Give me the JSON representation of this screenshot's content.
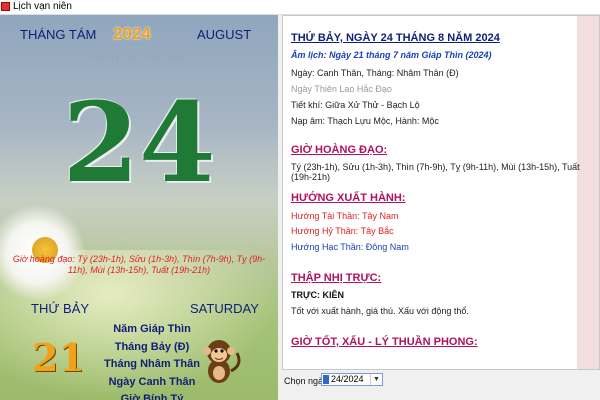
{
  "window": {
    "title": "Lịch vạn niên"
  },
  "left": {
    "month_vn": "THÁNG TÁM",
    "year": "2024",
    "month_en": "AUGUST",
    "day_quality": "THIÊN LAO HẮC ĐẠO",
    "day_number": "24",
    "gio_hoang_dao": "Giờ hoàng đạo: Tý (23h-1h), Sửu (1h-3h), Thìn (7h-9h), Tỵ (9h-11h), Mùi (13h-15h), Tuất (19h-21h)",
    "weekday_vn": "THỨ BẢY",
    "weekday_en": "SATURDAY",
    "lunar_day": "21",
    "lunar_lines": [
      "Năm Giáp Thìn",
      "Tháng Bảy (Đ)",
      "Tháng Nhâm Thân",
      "Ngày Canh Thân",
      "Giờ Bính Tý"
    ]
  },
  "right": {
    "heading": "THỨ BẢY, NGÀY 24 THÁNG 8 NĂM 2024",
    "lunar_date": "Âm lịch: Ngày 21 tháng 7 năm Giáp Thìn (2024)",
    "day_month": "Ngày: Canh Thân, Tháng: Nhâm Thân (Đ)",
    "day_quality": "Ngày Thiên Lao Hắc Đạo",
    "tiet_khi": "Tiết khí: Giữa Xử Thử - Bạch Lộ",
    "nap_am": "Nạp âm: Thạch Lựu Mộc, Hành: Mộc",
    "sec_gio": "GIỜ HOÀNG ĐẠO:",
    "gio_list": "Tý (23h-1h), Sửu (1h-3h), Thìn (7h-9h), Tỵ (9h-11h), Mùi (13h-15h), Tuất (19h-21h)",
    "sec_huong": "HƯỚNG XUẤT HÀNH:",
    "huong_tai": "Hướng Tài Thần: Tây Nam",
    "huong_hy": "Hướng Hỷ Thần: Tây Bắc",
    "huong_hac": "Hướng Hạc Thần: Đông Nam",
    "sec_truc": "THẬP NHỊ TRỰC:",
    "truc_name": "TRỰC: KIÊN",
    "truc_desc": "Tốt với xuất hành, giá thú. Xấu với động thổ.",
    "sec_gio_tot": "GIỜ TỐT, XẤU - LÝ THUẦN PHONG:"
  },
  "bottom": {
    "label": "Chọn ngày:",
    "date_value": "24/2024"
  },
  "icons": {
    "app": "calendar-icon",
    "dropdown": "dropdown-arrow-icon",
    "mascot": "monkey-icon"
  }
}
